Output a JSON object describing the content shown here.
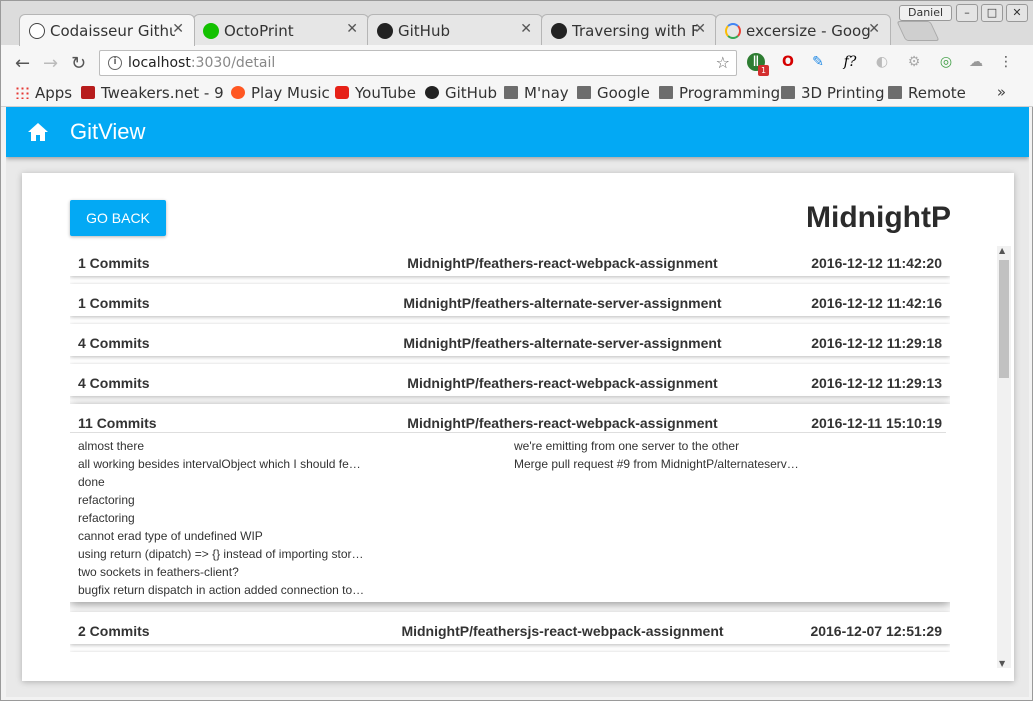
{
  "browser": {
    "tabs": [
      {
        "title": "Codaisseur Githu",
        "icon": "codaisseur-icon",
        "active": true
      },
      {
        "title": "OctoPrint",
        "icon": "octoprint-icon",
        "active": false
      },
      {
        "title": "GitHub",
        "icon": "github-icon",
        "active": false
      },
      {
        "title": "Traversing with F",
        "icon": "github-icon",
        "active": false
      },
      {
        "title": "excersize - Goog",
        "icon": "google-icon",
        "active": false
      }
    ],
    "user": "Daniel",
    "address": {
      "host": "localhost",
      "path": ":3030/detail"
    },
    "bookmarks": [
      {
        "label": "Apps",
        "icon": "apps-grid-icon"
      },
      {
        "label": "Tweakers.net - 9",
        "icon": "tweakers-icon"
      },
      {
        "label": "Play Music",
        "icon": "play-music-icon"
      },
      {
        "label": "YouTube",
        "icon": "youtube-icon"
      },
      {
        "label": "GitHub",
        "icon": "github-icon"
      },
      {
        "label": "M'nay",
        "icon": "folder-icon"
      },
      {
        "label": "Google",
        "icon": "folder-icon"
      },
      {
        "label": "Programming",
        "icon": "folder-icon"
      },
      {
        "label": "3D Printing",
        "icon": "folder-icon"
      },
      {
        "label": "Remote",
        "icon": "folder-icon"
      }
    ],
    "bookmarks_more": "»",
    "extension_badge": "1"
  },
  "app": {
    "title": "GitView",
    "accent": "#03a9f4",
    "go_back_label": "GO BACK",
    "user_name": "MidnightP"
  },
  "events": [
    {
      "commits": "1 Commits",
      "repo": "MidnightP/feathers-react-webpack-assignment",
      "date": "2016-12-12 11:42:20"
    },
    {
      "commits": "1 Commits",
      "repo": "MidnightP/feathers-alternate-server-assignment",
      "date": "2016-12-12 11:42:16"
    },
    {
      "commits": "4 Commits",
      "repo": "MidnightP/feathers-alternate-server-assignment",
      "date": "2016-12-12 11:29:18"
    },
    {
      "commits": "4 Commits",
      "repo": "MidnightP/feathers-react-webpack-assignment",
      "date": "2016-12-12 11:29:13"
    },
    {
      "commits": "11 Commits",
      "repo": "MidnightP/feathers-react-webpack-assignment",
      "date": "2016-12-11 15:10:19",
      "messages_left": [
        "almost there",
        "all working besides intervalObject which I should fe…",
        "done",
        "refactoring",
        "refactoring",
        "cannot erad type of undefined WIP",
        "using return (dipatch) => {} instead of importing stor…",
        "two sockets in feathers-client?",
        "bugfix return dispatch in action added connection to…"
      ],
      "messages_right": [
        "we're emitting from one server to the other",
        "Merge pull request #9 from MidnightP/alternateserv…"
      ]
    },
    {
      "commits": "2 Commits",
      "repo": "MidnightP/feathersjs-react-webpack-assignment",
      "date": "2016-12-07 12:51:29"
    }
  ]
}
